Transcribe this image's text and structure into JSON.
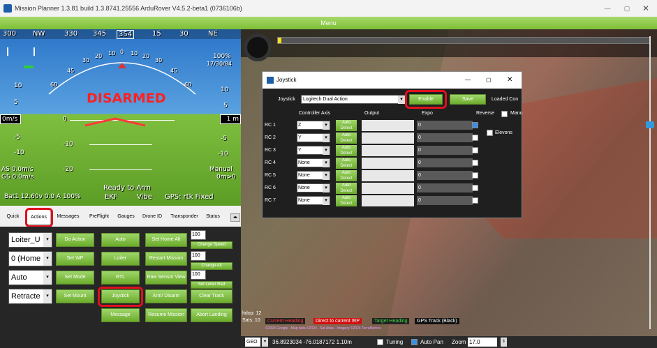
{
  "window": {
    "title": "Mission Planner 1.3.81 build 1.3.8741.25556 ArduRover V4.5.2-beta1 (0736106b)",
    "menu": "Menu"
  },
  "hud": {
    "heading_tape": [
      "300",
      "NW",
      "330",
      "345",
      "354",
      "15",
      "30",
      "NE"
    ],
    "status": "DISARMED",
    "ready": "Ready to Arm",
    "left_scale": [
      "10",
      "5",
      "-5",
      "-10"
    ],
    "right_scale": [
      "10",
      "5",
      "-5",
      "-10"
    ],
    "left_box": "0m/s",
    "right_box": "1 m",
    "pitch_labels": [
      "0",
      "-10",
      "-20"
    ],
    "roll_labels": [
      "60",
      "45",
      "30",
      "20",
      "10",
      "0",
      "10",
      "20",
      "30",
      "45",
      "60"
    ],
    "airspeed": "AS 0.0m/s",
    "groundspeed": "GS 0.0m/s",
    "mode": "Manual",
    "wp": "0m>0",
    "battery": "Bat1 12.60v 0.0 A 100%",
    "ekf": "EKF",
    "vibe": "Vibe",
    "gps": "GPS: rtk Fixed",
    "signal": "100%",
    "signal2": "17/30/84"
  },
  "tabs": [
    "Quick",
    "Actions",
    "Messages",
    "PreFlight",
    "Gauges",
    "Drone ID",
    "Transponder",
    "Status"
  ],
  "actions": {
    "dropdowns": [
      "Loiter_U",
      "0 (Home",
      "Auto",
      "Retracte"
    ],
    "buttons": {
      "do_action": "Do Action",
      "auto": "Auto",
      "set_home_alt": "Set Home Alt",
      "set_wp": "Set WP",
      "loiter": "Loiter",
      "restart_mission": "Restart Mission",
      "set_mode": "Set Mode",
      "rtl": "RTL",
      "raw_sensor_view": "Raw Sensor View",
      "set_mount": "Set Mount",
      "joystick": "Joystick",
      "arm_disarm": "Arm/ Disarm",
      "clear_track": "Clear Track",
      "message": "Message",
      "resume_mission": "Resume Mission",
      "abort_landing": "Abort Landing",
      "change_speed": "Change Speed",
      "change_alt": "Change Alt",
      "set_loiter_rad": "Set Loiter Rad"
    },
    "spinners": [
      "100",
      "100",
      "100"
    ]
  },
  "joystick": {
    "title": "Joystick",
    "label": "Joystick",
    "device": "Logitech Dual Action",
    "enable": "Enable",
    "save": "Save",
    "loaded": "Loaded Con",
    "headers": {
      "axis": "Controller Axis",
      "output": "Output",
      "expo": "Expo",
      "reverse": "Reverse",
      "manual": "Manu"
    },
    "elevons": "Elevons",
    "detect": "Auto Detect",
    "rows": [
      {
        "name": "RC 1",
        "axis": "Z",
        "expo": "0"
      },
      {
        "name": "RC 2",
        "axis": "Y",
        "expo": "0"
      },
      {
        "name": "RC 3",
        "axis": "Y",
        "expo": "0"
      },
      {
        "name": "RC 4",
        "axis": "None",
        "expo": "0"
      },
      {
        "name": "RC 5",
        "axis": "None",
        "expo": "0"
      },
      {
        "name": "RC 6",
        "axis": "None",
        "expo": "0"
      },
      {
        "name": "RC 7",
        "axis": "None",
        "expo": "0"
      }
    ]
  },
  "map": {
    "hdop": "hdop: 12",
    "sats": "Sats: 10",
    "legend": [
      "Current Heading",
      "Direct to current WP",
      "Target Heading",
      "GPS Track (Black)"
    ],
    "attribution": "©2024 Google - Map data ©2024 - Sat Atlas - Imagery ©2024 TerraMetrics"
  },
  "statusbar": {
    "coord_type": "GEO",
    "coords": "36.8923034 -76.0187172 1.10m",
    "tuning": "Tuning",
    "autopan": "Auto Pan",
    "zoom_label": "Zoom",
    "zoom": "17.0"
  },
  "colors": {
    "green": "#7cbf35",
    "red_highlight": "#e0101e",
    "sky": "#2b74c8",
    "ground": "#5c9d26"
  }
}
